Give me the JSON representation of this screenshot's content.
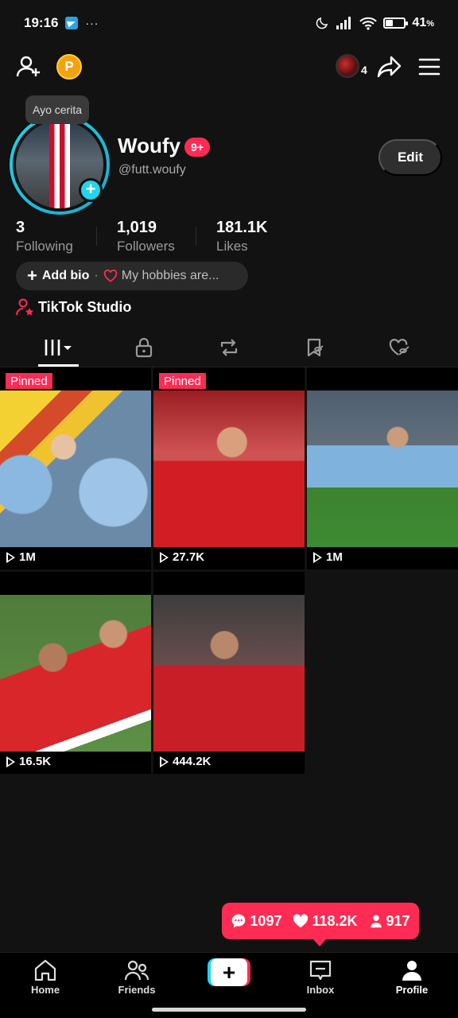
{
  "status_bar": {
    "time": "19:16",
    "dots": "···",
    "battery_percent": 41,
    "battery_text": "41",
    "battery_unit": "%"
  },
  "top_bar": {
    "coin_label": "P",
    "notif_count": "4"
  },
  "profile": {
    "tooltip": "Ayo cerita",
    "display_name": "Woufy",
    "badge": "9+",
    "handle": "@futt.woufy",
    "edit_label": "Edit"
  },
  "stats": [
    {
      "value": "3",
      "label": "Following"
    },
    {
      "value": "1,019",
      "label": "Followers"
    },
    {
      "value": "181.1K",
      "label": "Likes"
    }
  ],
  "bio": {
    "add_label": "Add bio",
    "separator": "·",
    "hint": "My hobbies are..."
  },
  "studio_label": "TikTok Studio",
  "tabs": [
    "videos",
    "private",
    "reposts",
    "favorites",
    "liked"
  ],
  "videos": [
    {
      "pinned": "Pinned",
      "views": "1M"
    },
    {
      "pinned": "Pinned",
      "views": "27.7K"
    },
    {
      "pinned": "",
      "views": "1M"
    },
    {
      "pinned": "",
      "views": "16.5K"
    },
    {
      "pinned": "",
      "views": "444.2K"
    }
  ],
  "toast": {
    "comments": "1097",
    "likes": "118.2K",
    "followers": "917"
  },
  "bottom_nav": {
    "home": "Home",
    "friends": "Friends",
    "create": "+",
    "inbox": "Inbox",
    "profile": "Profile"
  },
  "colors": {
    "accent": "#fe2c55",
    "cyan": "#20d5ec",
    "background": "#121212"
  }
}
